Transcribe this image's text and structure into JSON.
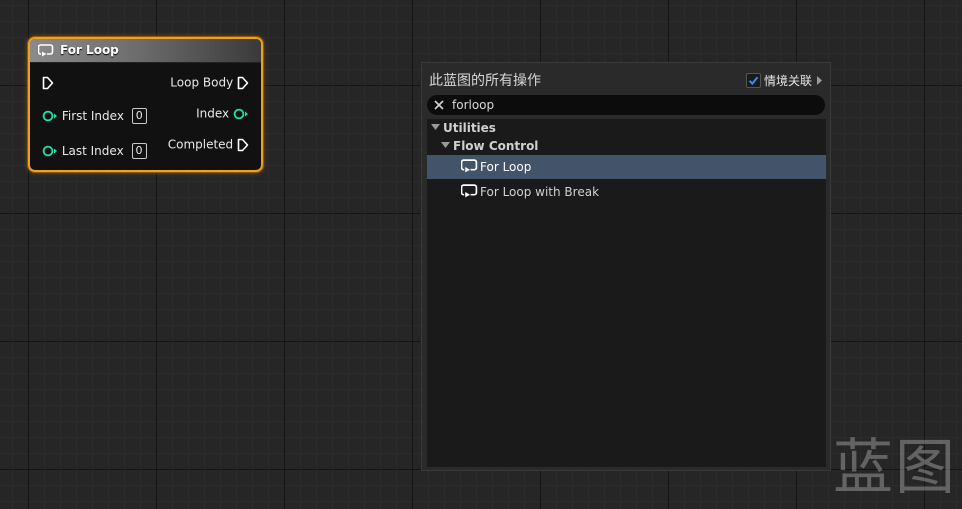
{
  "node": {
    "title": "For Loop",
    "pins_left": [
      {
        "label": "",
        "kind": "exec"
      },
      {
        "label": "First Index",
        "kind": "int",
        "value": "0"
      },
      {
        "label": "Last Index",
        "kind": "int",
        "value": "0"
      }
    ],
    "pins_right": [
      {
        "label": "Loop Body",
        "kind": "exec"
      },
      {
        "label": "Index",
        "kind": "int"
      },
      {
        "label": "Completed",
        "kind": "exec"
      }
    ],
    "colors": {
      "selection_border": "#f0a020",
      "int_pin": "#1fe0a8",
      "exec_pin": "#ffffff"
    }
  },
  "action_menu": {
    "title": "此蓝图的所有操作",
    "context_sensitive_label": "情境关联",
    "context_sensitive_checked": true,
    "search_value": "forloop",
    "categories": [
      {
        "label": "Utilities",
        "expanded": true
      },
      {
        "label": "Flow Control",
        "expanded": true
      }
    ],
    "items": [
      {
        "label": "For Loop",
        "icon": "macro-loop-icon",
        "selected": true
      },
      {
        "label": "For Loop with Break",
        "icon": "macro-loop-icon",
        "selected": false
      }
    ],
    "colors": {
      "selected_row": "#43536a",
      "checkbox_check": "#3d8cf0"
    }
  },
  "watermark": "蓝图"
}
